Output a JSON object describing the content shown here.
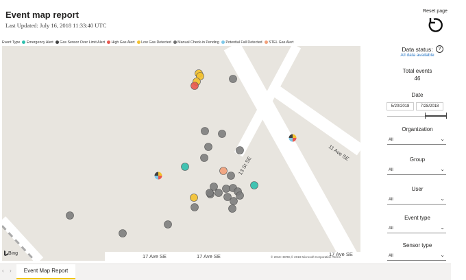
{
  "header": {
    "title": "Event map report",
    "last_updated": "Last Updated: July 16, 2018 11:33:40 UTC",
    "reset_label": "Reset page"
  },
  "legend": {
    "title": "Event Type",
    "items": [
      {
        "label": "Emergency Alert",
        "color": "#2fbfad"
      },
      {
        "label": "Gas Sensor Over Limit Alert",
        "color": "#404040"
      },
      {
        "label": "High Gas Alert",
        "color": "#e8584f"
      },
      {
        "label": "Low Gas Detected",
        "color": "#f4c12e"
      },
      {
        "label": "Manual Check-in Pending",
        "color": "#707070"
      },
      {
        "label": "Potential Fall Detected",
        "color": "#7ec8e8"
      },
      {
        "label": "STEL Gas Alert",
        "color": "#f2a07a"
      }
    ]
  },
  "map": {
    "roads": [
      "13 St SE",
      "11 Ave SE",
      "17 Ave SE",
      "17 Ave SE",
      "17 Ave SE"
    ],
    "copyright": "© 2018 HERE,© 2018 Microsoft Corporation Terms",
    "logo": "Bing"
  },
  "sidebar": {
    "data_status_label": "Data status:",
    "data_status_value": "All data available",
    "total_events_label": "Total events",
    "total_events_value": "46",
    "date_label": "Date",
    "date_from": "5/20/2018",
    "date_to": "7/28/2018",
    "organization_label": "Organization",
    "organization_value": "All",
    "group_label": "Group",
    "group_value": "All",
    "user_label": "User",
    "user_value": "All",
    "event_type_label": "Event type",
    "event_type_value": "All",
    "sensor_type_label": "Sensor type",
    "sensor_type_value": "All"
  },
  "tabs": {
    "active": "Event Map Report",
    "prev_icon": "chevron-left-icon",
    "next_icon": "chevron-right-icon"
  },
  "colors": {
    "gray_marker": "#7d7d7d",
    "map_bg": "#e8e5df",
    "link": "#2b78c5"
  }
}
